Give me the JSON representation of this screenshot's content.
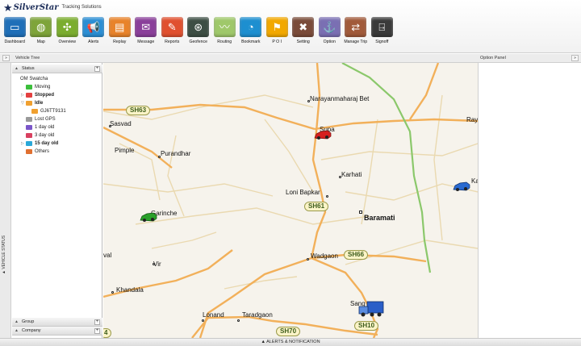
{
  "header": {
    "brand": "SilverStar",
    "tagline": "Tracking Solutions"
  },
  "toolbar": [
    {
      "label": "Dashboard",
      "icon": "monitor-icon",
      "glyph": "▭",
      "color": "#1f6fb8"
    },
    {
      "label": "Map",
      "icon": "globe-icon",
      "glyph": "◍",
      "color": "#7ea43a"
    },
    {
      "label": "Overview",
      "icon": "radiation-icon",
      "glyph": "✣",
      "color": "#7bad2f"
    },
    {
      "label": "Alerts",
      "icon": "megaphone-icon",
      "glyph": "📢",
      "color": "#2b8ed4"
    },
    {
      "label": "Replay",
      "icon": "clapper-icon",
      "glyph": "▤",
      "color": "#e8832a"
    },
    {
      "label": "Message",
      "icon": "envelope-icon",
      "glyph": "✉",
      "color": "#8a3f9a"
    },
    {
      "label": "Reports",
      "icon": "pen-icon",
      "glyph": "✎",
      "color": "#e0502f"
    },
    {
      "label": "Geofence",
      "icon": "geofence-icon",
      "glyph": "⊛",
      "color": "#3d4e44"
    },
    {
      "label": "Routing",
      "icon": "chart-line-icon",
      "glyph": "〰",
      "color": "#9fc86a"
    },
    {
      "label": "Bookmark",
      "icon": "bookmark-pin-icon",
      "glyph": "◔",
      "color": "#1d8fd0"
    },
    {
      "label": "P O I",
      "icon": "poi-flag-icon",
      "glyph": "⚑",
      "color": "#f2a800"
    },
    {
      "label": "Setting",
      "icon": "tools-icon",
      "glyph": "✖",
      "color": "#7a4b39"
    },
    {
      "label": "Option",
      "icon": "anchor-icon",
      "glyph": "⚓",
      "color": "#7a6fb3"
    },
    {
      "label": "Manage Trip",
      "icon": "trip-icon",
      "glyph": "⇄",
      "color": "#a15a3a"
    },
    {
      "label": "Signoff",
      "icon": "door-exit-icon",
      "glyph": "⍈",
      "color": "#3a3a3a"
    }
  ],
  "panels": {
    "vehicle_tree_title": "Vehicle Tree",
    "option_panel_title": "Option Panel",
    "vehicle_status_label": "▲ VEHICLE STATUS",
    "collapse_glyph": "»"
  },
  "tree": {
    "status_header": "Status",
    "group_header": "Group",
    "company_header": "Company",
    "items": [
      {
        "label": "OM Swatcha",
        "color": "",
        "bold": false,
        "expander": "",
        "indent": 0
      },
      {
        "label": "Moving",
        "color": "#3cbf3c",
        "bold": false,
        "expander": "",
        "indent": 1
      },
      {
        "label": "Stopped",
        "color": "#e34040",
        "bold": true,
        "expander": "▷",
        "indent": 1
      },
      {
        "label": "Idle",
        "color": "#f0a030",
        "bold": true,
        "expander": "▽",
        "indent": 1
      },
      {
        "label": "GJ6TT9131",
        "color": "#f0a030",
        "bold": false,
        "expander": "",
        "indent": 2
      },
      {
        "label": "Lost GPS",
        "color": "#9a9a9a",
        "bold": false,
        "expander": "",
        "indent": 1
      },
      {
        "label": "1 day old",
        "color": "#7a56c9",
        "bold": false,
        "expander": "",
        "indent": 1
      },
      {
        "label": "3 day old",
        "color": "#d84060",
        "bold": false,
        "expander": "",
        "indent": 1
      },
      {
        "label": "15 day old",
        "color": "#2aa8d8",
        "bold": true,
        "expander": "▷",
        "indent": 1
      },
      {
        "label": "Others",
        "color": "#e07030",
        "bold": false,
        "expander": "",
        "indent": 1
      }
    ]
  },
  "map": {
    "towns": [
      {
        "name": "Narayanmaharaj Bet"
      },
      {
        "name": "Sasvad"
      },
      {
        "name": "Supa"
      },
      {
        "name": "Ray"
      },
      {
        "name": "Pimple"
      },
      {
        "name": "Purandhar"
      },
      {
        "name": "Karhati"
      },
      {
        "name": "Loni Bapkar"
      },
      {
        "name": "Baramati"
      },
      {
        "name": "Garinche"
      },
      {
        "name": "Kat"
      },
      {
        "name": "Wadgaon"
      },
      {
        "name": "val"
      },
      {
        "name": "Vir"
      },
      {
        "name": "Khandala"
      },
      {
        "name": "Lonand"
      },
      {
        "name": "Taradgaon"
      },
      {
        "name": "Sang"
      }
    ],
    "highways": [
      "SH63",
      "SH61",
      "SH66",
      "SH70",
      "SH10",
      "4"
    ],
    "vehicles": [
      {
        "name": "red-car",
        "color": "#d62020"
      },
      {
        "name": "green-car",
        "color": "#2aa02a"
      },
      {
        "name": "blue-car",
        "color": "#2a6ad0"
      },
      {
        "name": "blue-truck",
        "color": "#2a5ec8"
      }
    ]
  },
  "footer": {
    "label": "▲ ALERTS & NOTIFICATION"
  }
}
